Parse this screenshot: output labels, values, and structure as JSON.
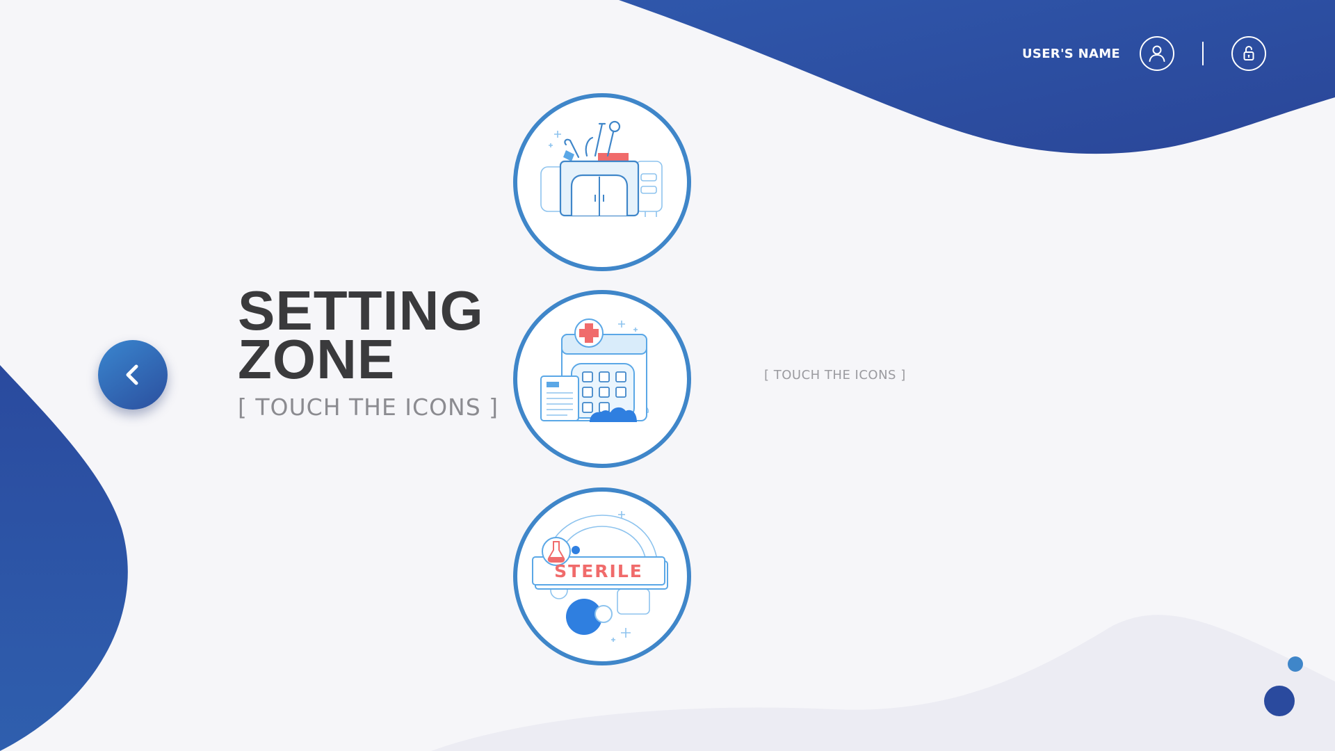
{
  "header": {
    "user_name": "USER'S NAME",
    "user_icon": "user-icon",
    "lock_icon": "unlock-icon"
  },
  "main": {
    "title_line1": "SETTING",
    "title_line2": "ZONE",
    "subtitle": "[ TOUCH THE ICONS ]",
    "hint": "[ TOUCH THE ICONS ]",
    "back_icon": "chevron-left-icon"
  },
  "zones": [
    {
      "icon": "dental-tools-icon"
    },
    {
      "icon": "hospital-icon"
    },
    {
      "icon": "sterile-icon",
      "label": "STERILE"
    }
  ],
  "colors": {
    "primary_blue": "#2a4a9e",
    "accent_blue": "#3f86c9",
    "light_blue": "#5aa7e6",
    "title_dark": "#3a3a3c",
    "subtitle_grey": "#8b8b90",
    "accent_red": "#f06b6b",
    "background": "#f6f6f9"
  }
}
